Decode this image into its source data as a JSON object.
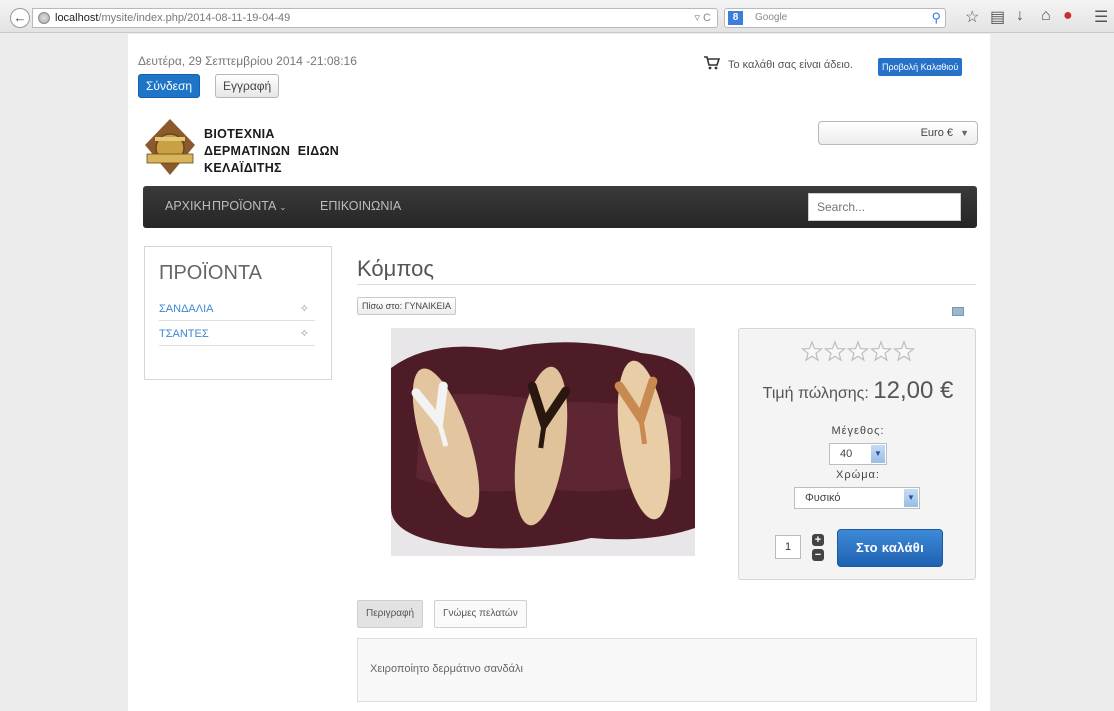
{
  "browser": {
    "url_host": "localhost",
    "url_path": "/mysite/index.php/2014-08-11-19-04-49",
    "search_engine_placeholder": "Google"
  },
  "header": {
    "date_text": "Δευτέρα, 29 Σεπτεμβρίου 2014 -21:08:16",
    "login_label": "Σύνδεση",
    "register_label": "Εγγραφή",
    "cart_status": "Το καλάθι σας είναι άδειο.",
    "view_cart_label": "Προβολή Καλαθιού",
    "currency_selected": "Euro €"
  },
  "logo": {
    "line1": "ΒΙΟΤΕΧΝΙΑ",
    "line2": "ΔΕΡΜΑΤΙΝΩΝ  ΕΙΔΩΝ",
    "line3": "ΚΕΛΑΪΔΙΤΗΣ"
  },
  "nav": {
    "items": [
      "ΑΡΧΙΚΗ",
      "ΠΡΟΪΟΝΤΑ",
      "ΕΠΙΚΟΙΝΩΝΙΑ"
    ],
    "search_placeholder": "Search..."
  },
  "sidebar": {
    "title": "ΠΡΟΪΟΝΤΑ",
    "items": [
      "ΣΑΝΔΑΛΙΑ",
      "ΤΣΑΝΤΕΣ"
    ]
  },
  "product": {
    "title": "Κόμπος",
    "back_label": "Πίσω στο: ΓΥΝΑΙΚΕΙΑ",
    "rating_stars": 0,
    "rating_max": 5,
    "price_label": "Τιμή πώλησης:",
    "price_value": "12,00 €",
    "size_label": "Μέγεθος:",
    "size_value": "40",
    "color_label": "Χρώμα:",
    "color_value": "Φυσικό",
    "quantity": "1",
    "add_to_cart_label": "Στο καλάθι"
  },
  "tabs": {
    "description_label": "Περιγραφή",
    "reviews_label": "Γνώμες πελατών",
    "description_text": "Χειροποίητο δερμάτινο σανδάλι"
  }
}
